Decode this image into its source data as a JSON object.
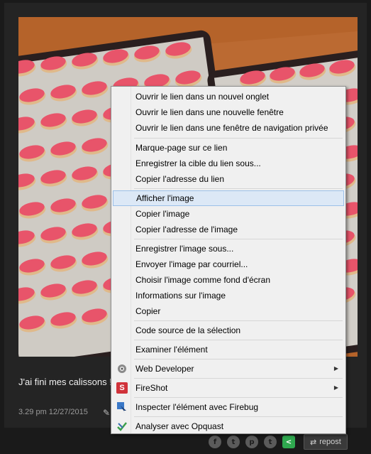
{
  "post": {
    "caption": "J'ai fini mes calissons !",
    "timestamp": "3.29 pm 12/27/2015"
  },
  "actions": {
    "facebook": "f",
    "twitter": "t",
    "pinterest": "p",
    "tumblr": "t",
    "share": "<",
    "repost_label": "repost"
  },
  "menu": {
    "items": [
      {
        "label": "Ouvrir le lien dans un nouvel onglet"
      },
      {
        "label": "Ouvrir le lien dans une nouvelle fenêtre"
      },
      {
        "label": "Ouvrir le lien dans une fenêtre de navigation privée"
      },
      {
        "label": "Marque-page sur ce lien"
      },
      {
        "label": "Enregistrer la cible du lien sous..."
      },
      {
        "label": "Copier l'adresse du lien"
      },
      {
        "label": "Afficher l'image"
      },
      {
        "label": "Copier l'image"
      },
      {
        "label": "Copier l'adresse de l'image"
      },
      {
        "label": "Enregistrer l'image sous..."
      },
      {
        "label": "Envoyer l'image par courriel..."
      },
      {
        "label": "Choisir l'image comme fond d'écran"
      },
      {
        "label": "Informations sur l'image"
      },
      {
        "label": "Copier"
      },
      {
        "label": "Code source de la sélection"
      },
      {
        "label": "Examiner l'élément"
      },
      {
        "label": "Web Developer",
        "icon": "gear-icon"
      },
      {
        "label": "FireShot",
        "icon": "fireshot-icon",
        "icon_text": "S"
      },
      {
        "label": "Inspecter l'élément avec Firebug",
        "icon": "firebug-icon"
      },
      {
        "label": "Analyser avec Opquast",
        "icon": "opquast-icon"
      }
    ]
  },
  "colors": {
    "highlight": "#dce8f6",
    "cookie_icing": "#e8546a",
    "tray": "#2a1f1f",
    "table_wood": "#b5632a"
  }
}
